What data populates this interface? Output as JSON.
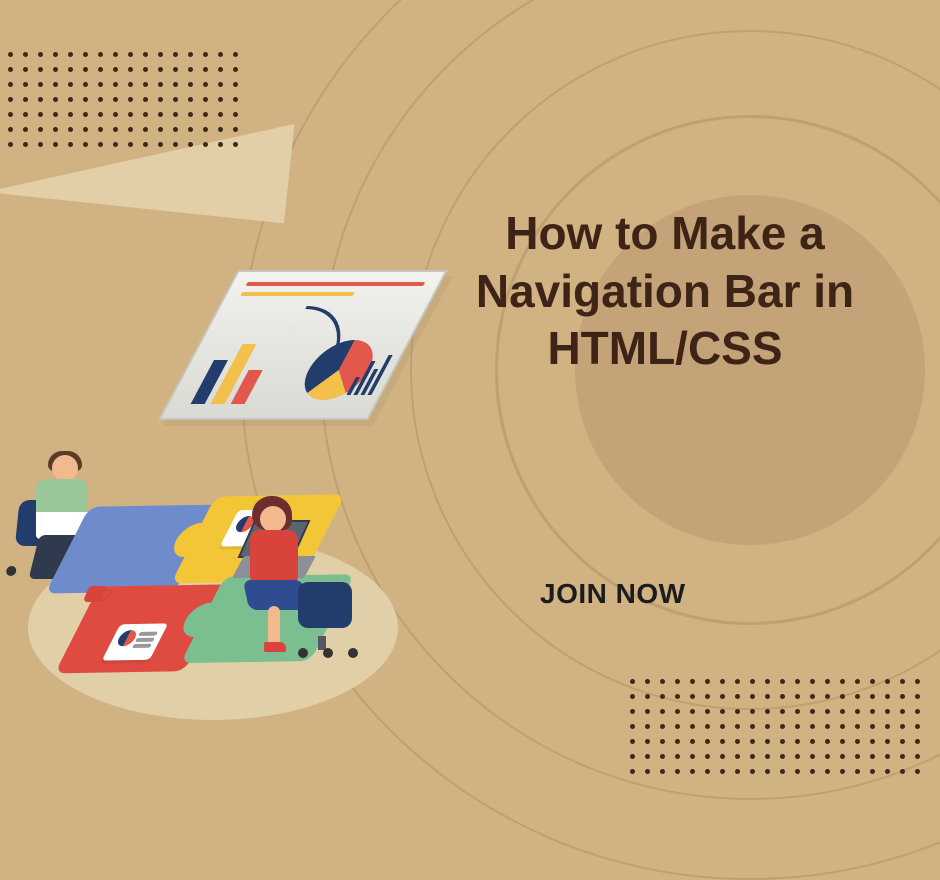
{
  "headline": "How to Make a Navigation Bar in HTML/CSS",
  "cta_label": "JOIN NOW"
}
